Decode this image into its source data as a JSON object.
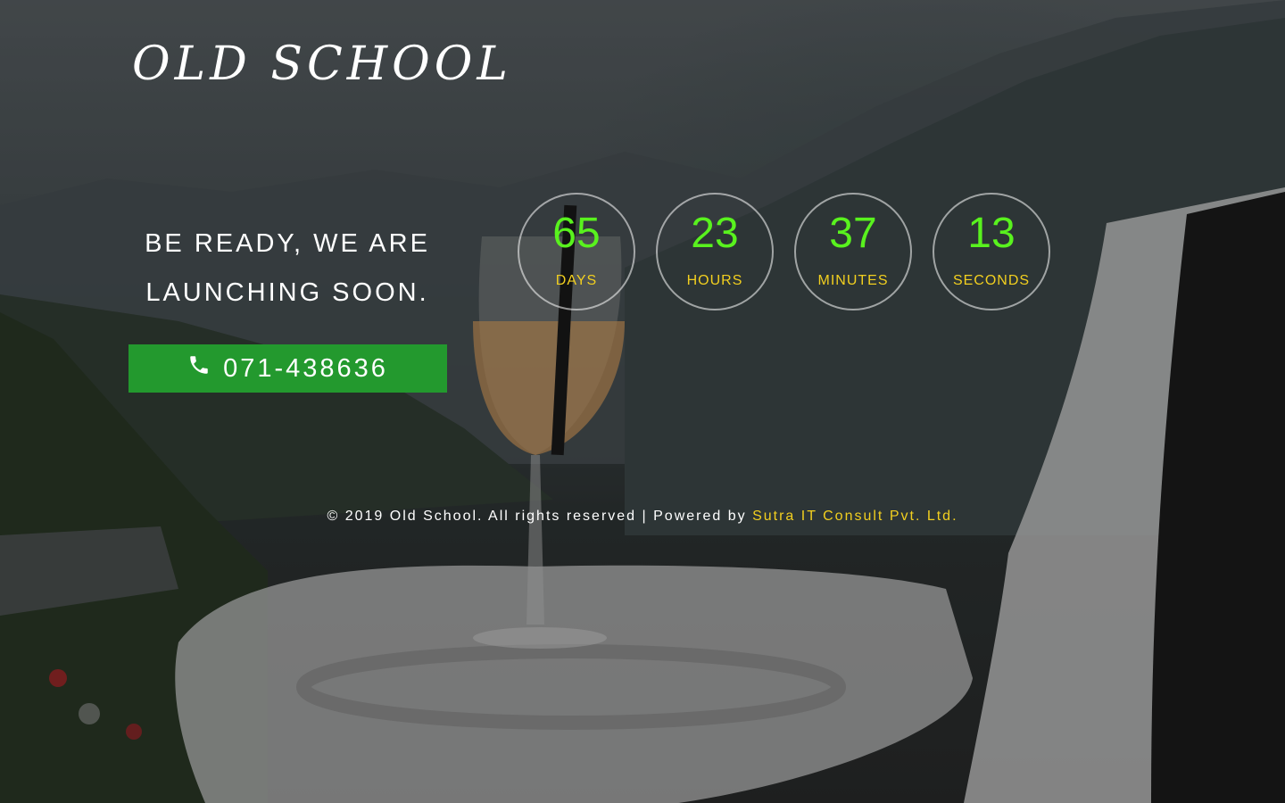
{
  "brand": {
    "logo_text": "OLD SCHOOL"
  },
  "hero": {
    "tagline_line1": "BE READY, WE ARE",
    "tagline_line2": "LAUNCHING SOON.",
    "phone_label": "071-438636",
    "phone_icon": "phone-icon"
  },
  "countdown": {
    "days": {
      "value": "65",
      "label": "DAYS"
    },
    "hours": {
      "value": "23",
      "label": "HOURS"
    },
    "minutes": {
      "value": "37",
      "label": "MINUTES"
    },
    "seconds": {
      "value": "13",
      "label": "SECONDS"
    }
  },
  "footer": {
    "copyright_text": "© 2019 Old School. All rights reserved | Powered by ",
    "company_link": "Sutra IT Consult Pvt. Ltd."
  },
  "colors": {
    "accent_green": "#59f21e",
    "label_yellow": "#f2cf1f",
    "button_green": "#23992e"
  }
}
